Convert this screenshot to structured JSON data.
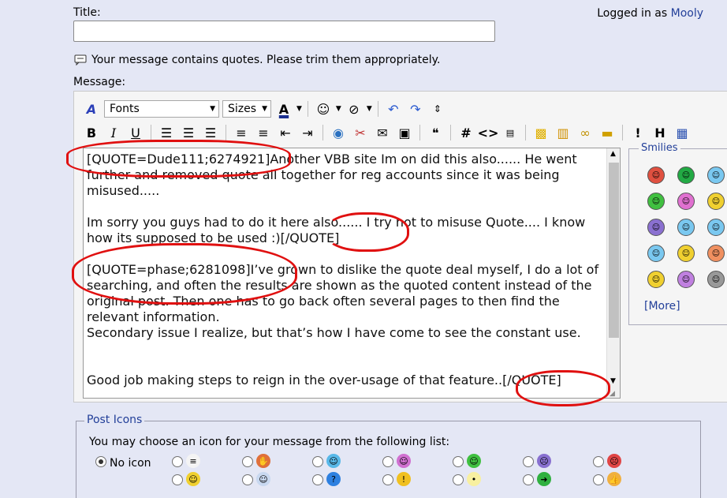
{
  "title_label": "Title:",
  "title_value": "",
  "logged_in_prefix": "Logged in as",
  "username": "Mooly",
  "quote_warning": "Your message contains quotes. Please trim them appropriately.",
  "message_label": "Message:",
  "toolbar": {
    "fonts_label": "Fonts",
    "sizes_label": "Sizes",
    "hash_label": "#",
    "code_label": "<>"
  },
  "message_text": "[QUOTE=Dude111;6274921]Another VBB site Im on did this also...... He went further and removed quote all together for reg accounts since it was being misused.....\n\nIm sorry you guys had to do it here also...... I try not to misuse Quote.... I know how its supposed to be used :)[/QUOTE]\n\n[QUOTE=phase;6281098]I’ve grown to dislike the quote deal myself, I do a lot of searching, and often the results are shown as the quoted content instead of the original post. Then one has to go back often several pages to then find the relevant information.\nSecondary issue I realize, but that’s how I have come to see the constant use.\n\n\nGood job making steps to reign in the over-usage of that feature..[/QUOTE]",
  "smilies": {
    "legend": "Smilies",
    "more_label": "[More]",
    "colors": [
      "#e05040",
      "#22aa44",
      "#7ac8f0",
      "#40c040",
      "#e070d0",
      "#f0d030",
      "#8a70d0",
      "#7ac8f0",
      "#7ac8f0",
      "#7ac8f0",
      "#f0d030",
      "#f09060",
      "#f0d030",
      "#c080e0",
      "#999999"
    ]
  },
  "post_icons": {
    "legend": "Post Icons",
    "description": "You may choose an icon for your message from the following list:",
    "no_icon_label": "No icon",
    "icons": [
      {
        "name": "post-icon-document",
        "color": "#f4f4f4",
        "glyph": "≡"
      },
      {
        "name": "post-icon-thumbs-down",
        "color": "#e0703a",
        "glyph": "✋"
      },
      {
        "name": "post-icon-cool",
        "color": "#58b8e8",
        "glyph": "☺"
      },
      {
        "name": "post-icon-laugh",
        "color": "#d070d0",
        "glyph": "☺"
      },
      {
        "name": "post-icon-grin",
        "color": "#40c040",
        "glyph": "☺"
      },
      {
        "name": "post-icon-sad",
        "color": "#8870d0",
        "glyph": "☹"
      },
      {
        "name": "post-icon-angry",
        "color": "#e04545",
        "glyph": "☹"
      },
      {
        "name": "post-icon-smile",
        "color": "#f0d030",
        "glyph": "☺"
      },
      {
        "name": "post-icon-sunglasses",
        "color": "#c8d8f0",
        "glyph": "☺"
      },
      {
        "name": "post-icon-question",
        "color": "#2d80e0",
        "glyph": "?"
      },
      {
        "name": "post-icon-warning",
        "color": "#f0c020",
        "glyph": "!"
      },
      {
        "name": "post-icon-lightbulb",
        "color": "#f8f0a0",
        "glyph": "•"
      },
      {
        "name": "post-icon-arrow",
        "color": "#30b040",
        "glyph": "➜"
      },
      {
        "name": "post-icon-thumbs-up",
        "color": "#f0b040",
        "glyph": "👍"
      }
    ]
  }
}
